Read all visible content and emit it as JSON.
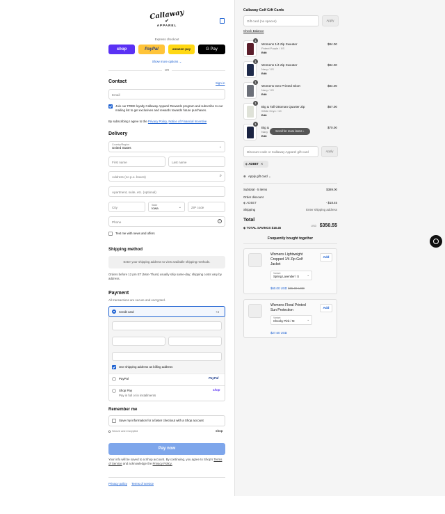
{
  "brand": {
    "logo_text": "Callaway",
    "sub": "APPAREL"
  },
  "express": {
    "label": "Express checkout",
    "shop": "shop",
    "paypal": "PayPal",
    "amazon": "amazon pay",
    "gpay": "G Pay",
    "more": "Show more options",
    "or": "OR"
  },
  "contact": {
    "title": "Contact",
    "signin": "Sign in",
    "email_ph": "Email",
    "loyalty": "Join our FREE loyalty Callaway Apparel Rewards program and subscribe to our mailing list to get exclusives and rewards towards future purchases.",
    "agree_prefix": "By subscribing I agree to the",
    "privacy": "Privacy Policy,",
    "notice": "Notice of Financial Incentive"
  },
  "delivery": {
    "title": "Delivery",
    "country_label": "Country/Region",
    "country": "United States",
    "first": "First name",
    "last": "Last name",
    "address": "Address (no p.o. boxes)",
    "apt": "Apartment, suite, etc. (optional)",
    "city": "City",
    "state_label": "State",
    "state": "Iowa",
    "zip": "ZIP code",
    "phone": "Phone",
    "text_me": "Text me with news and offers"
  },
  "shipping": {
    "title": "Shipping method",
    "note": "Enter your shipping address to view available shipping methods.",
    "info": "Orders before 12 pm ET (Mon-Thurs) usually ship same-day; shipping costs vary by address."
  },
  "payment": {
    "title": "Payment",
    "sub": "All transactions are secure and encrypted.",
    "cc": "Credit card",
    "cc_more": "+4",
    "billing": "Use shipping address as billing address",
    "paypal": "PayPal",
    "paypal_logo": "PayPal",
    "shoppay": "Shop Pay",
    "shoppay_sub": "Pay in full or in installments",
    "shoppay_logo": "shop"
  },
  "remember": {
    "title": "Remember me",
    "save": "Save my information for a faster checkout with a Shop account",
    "secure": "Secure and encrypted",
    "shop": "shop"
  },
  "pay": {
    "button": "Pay now",
    "terms_prefix": "Your info will be saved to a Shop account. By continuing, you agree to Shop's",
    "terms": "Terms of Service",
    "and": "and acknowledge the",
    "privacy": "Privacy Policy."
  },
  "footer": {
    "privacy": "Privacy policy",
    "tos": "Terms of service"
  },
  "gift": {
    "title": "Callaway Golf Gift Cards",
    "placeholder": "Gift card (no spaces)",
    "apply": "Apply",
    "check": "Check Balance"
  },
  "items": [
    {
      "qty": "1",
      "name": "Womens 1/4 Zip Sweater",
      "variant": "Potent Purple / XS",
      "edit": "Edit",
      "price": "$84.00",
      "color": "#5a1d2a"
    },
    {
      "qty": "1",
      "name": "Womens 1/4 Zip Sweater",
      "variant": "Navy / XS",
      "edit": "Edit",
      "price": "$84.00",
      "color": "#1e2a4a"
    },
    {
      "qty": "1",
      "name": "Womens Geo Printed Skort",
      "variant": "Navy / XS",
      "edit": "Edit",
      "price": "$84.00",
      "color": "#6b6f78"
    },
    {
      "qty": "1",
      "name": "Big & Tall Ottoman Quarter Zip",
      "variant": "White Onyx / 1X",
      "edit": "Edit",
      "price": "$67.00",
      "color": "#dfe2d8"
    },
    {
      "qty": "1",
      "name": "Big &",
      "variant": "Navy",
      "edit": "Edit",
      "price": "$70.00",
      "color": "#1b2442"
    }
  ],
  "scroll_tip": "Scroll for more items",
  "discount": {
    "placeholder": "Discount code or Callaway Apparel gift card",
    "apply": "Apply",
    "code": "ADBET",
    "gift": "Apply gift card"
  },
  "summary": {
    "subtotal_label": "Subtotal · 5 items",
    "subtotal": "$389.00",
    "order_discount": "Order discount",
    "code": "ADBET",
    "discount": "- $18.45",
    "shipping_label": "Shipping",
    "shipping": "Enter shipping address",
    "total_label": "Total",
    "currency": "USD",
    "total": "$350.55",
    "savings_label": "TOTAL SAVINGS",
    "savings": "$18.45"
  },
  "fbt": {
    "title": "Frequently bought together",
    "items": [
      {
        "name": "Womens Lightweight Cropped 1/4 Zip Golf Jacket",
        "variant_label": "Variant",
        "variant": "Spring Lavender / S",
        "price": "$60.00 USD",
        "old": "$65.00 USD",
        "add": "Add"
      },
      {
        "name": "Womens Floral Printed Sun Protection",
        "variant_label": "Variant",
        "variant": "Cheeky Pink / M",
        "price": "$27.60 USD",
        "old": "",
        "add": "Add"
      }
    ]
  },
  "colors": {
    "accent": "#1a5fd1",
    "shop_purple": "#5a31f4",
    "paypal_yellow": "#ffc439",
    "amazon_yellow": "#ffd814",
    "pay_button": "#7ea6eb"
  }
}
